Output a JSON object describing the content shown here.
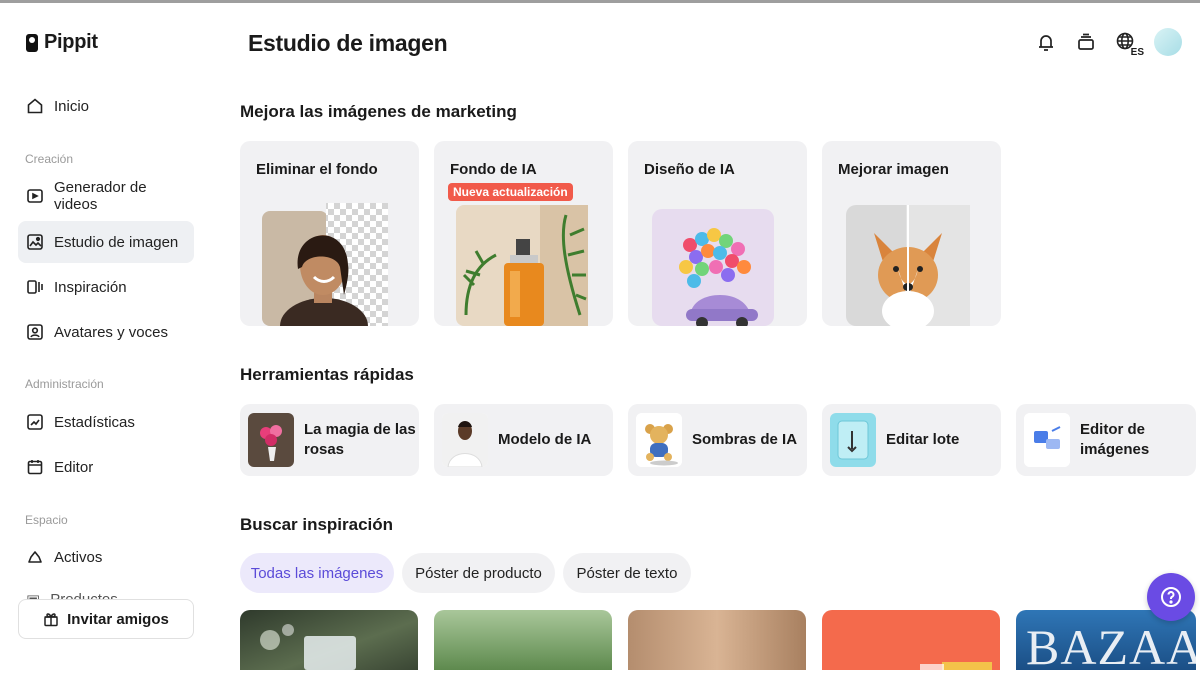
{
  "app": {
    "name": "Pippit"
  },
  "sidebar": {
    "home": "Inicio",
    "sections": [
      {
        "title": "Creación",
        "items": [
          "Generador de videos",
          "Estudio de imagen",
          "Inspiración",
          "Avatares y voces"
        ]
      },
      {
        "title": "Administración",
        "items": [
          "Estadísticas",
          "Editor"
        ]
      },
      {
        "title": "Espacio",
        "items": [
          "Activos",
          "Productos"
        ]
      }
    ],
    "active_item": "Estudio de imagen",
    "invite": "Invitar amigos"
  },
  "header": {
    "title": "Estudio de imagen",
    "icons": [
      "bell-icon",
      "stack-icon",
      "globe-icon",
      "avatar"
    ],
    "language": "ES"
  },
  "marketing": {
    "title": "Mejora las imágenes de marketing",
    "cards": [
      {
        "label": "Eliminar el fondo",
        "badge": ""
      },
      {
        "label": "Fondo de IA",
        "badge": "Nueva actualización"
      },
      {
        "label": "Diseño de IA",
        "badge": ""
      },
      {
        "label": "Mejorar imagen",
        "badge": ""
      }
    ]
  },
  "quick_tools": {
    "title": "Herramientas rápidas",
    "items": [
      {
        "label": "La magia de las rosas"
      },
      {
        "label": "Modelo de IA"
      },
      {
        "label": "Sombras de IA"
      },
      {
        "label": "Editar lote"
      },
      {
        "label": "Editor de imágenes"
      }
    ]
  },
  "inspiration": {
    "title": "Buscar inspiración",
    "filters": [
      "Todas las imágenes",
      "Póster de producto",
      "Póster de texto"
    ],
    "active_filter": "Todas las imágenes",
    "bazaar_text": "BAZAAR"
  },
  "colors": {
    "accent": "#6a4be4",
    "badge": "#f15a4a",
    "card_bg": "#f1f1f3",
    "active_chip_text": "#5b4bd8"
  }
}
